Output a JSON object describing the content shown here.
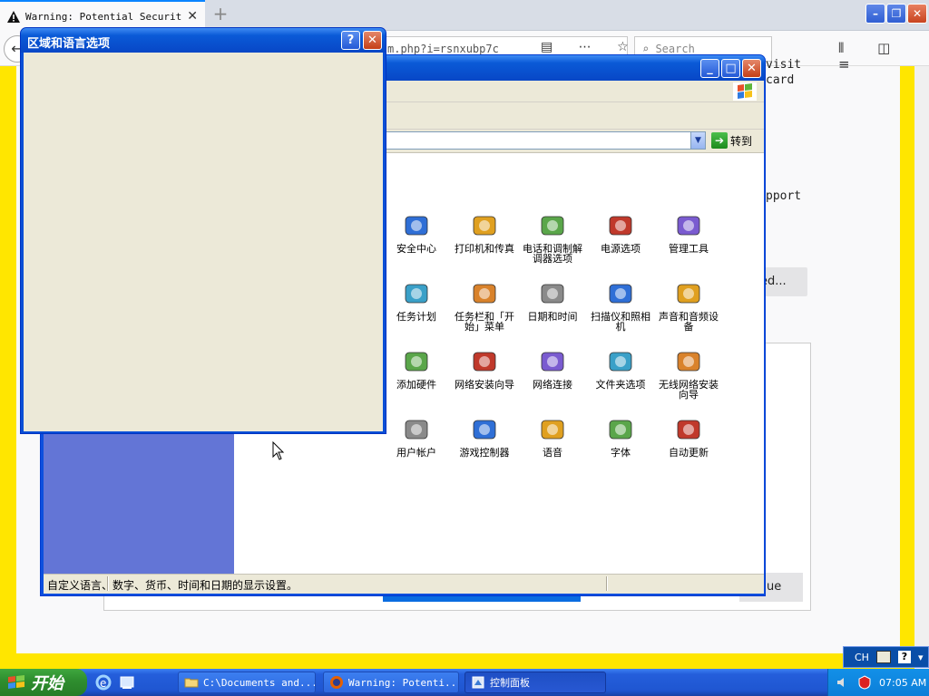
{
  "browser": {
    "tab_title": "Warning: Potential Security",
    "tab_close": "✕",
    "new_tab": "+",
    "url": "m.php?i=rsnxubp7c",
    "search_placeholder": "Search",
    "url_icons": "▤ ⋯ ☆",
    "right_icons": "⫴ ◫ ≡"
  },
  "page": {
    "text_visit": "visit",
    "text_card": "card",
    "text_support": "pport",
    "advanced_button": "ed...",
    "continue_button": "ue"
  },
  "control_panel": {
    "title": "控制面板",
    "goto_label": "转到",
    "status_text": "自定义语言、数字、货币、时间和日期的显示设置。",
    "items": [
      {
        "label": "安全中心",
        "icon": "shield-icon"
      },
      {
        "label": "打印机和传真",
        "icon": "printer-icon"
      },
      {
        "label": "电话和调制解调器选项",
        "icon": "phone-modem-icon"
      },
      {
        "label": "电源选项",
        "icon": "power-options-icon"
      },
      {
        "label": "管理工具",
        "icon": "admin-tools-icon"
      },
      {
        "label": "任务计划",
        "icon": "scheduled-tasks-icon"
      },
      {
        "label": "任务栏和「开始」菜单",
        "icon": "taskbar-start-icon"
      },
      {
        "label": "日期和时间",
        "icon": "clock-icon"
      },
      {
        "label": "扫描仪和照相机",
        "icon": "scanner-camera-icon"
      },
      {
        "label": "声音和音频设备",
        "icon": "speaker-icon"
      },
      {
        "label": "添加硬件",
        "icon": "add-hardware-icon"
      },
      {
        "label": "网络安装向导",
        "icon": "network-setup-icon"
      },
      {
        "label": "网络连接",
        "icon": "network-connections-icon"
      },
      {
        "label": "文件夹选项",
        "icon": "folder-options-icon"
      },
      {
        "label": "无线网络安装向导",
        "icon": "wireless-setup-icon"
      },
      {
        "label": "用户帐户",
        "icon": "user-accounts-icon"
      },
      {
        "label": "游戏控制器",
        "icon": "game-controller-icon"
      },
      {
        "label": "语音",
        "icon": "speech-icon"
      },
      {
        "label": "字体",
        "icon": "fonts-icon"
      },
      {
        "label": "自动更新",
        "icon": "windows-update-icon"
      }
    ]
  },
  "dialog": {
    "title": "区域和语言选项",
    "help_button": "?",
    "close_button": "✕"
  },
  "taskbar": {
    "start_label": "开始",
    "tasks": [
      {
        "label": "C:\\Documents and..."
      },
      {
        "label": "Warning: Potenti..."
      },
      {
        "label": "控制面板"
      }
    ],
    "clock": "07:05 AM",
    "language": "CH"
  }
}
